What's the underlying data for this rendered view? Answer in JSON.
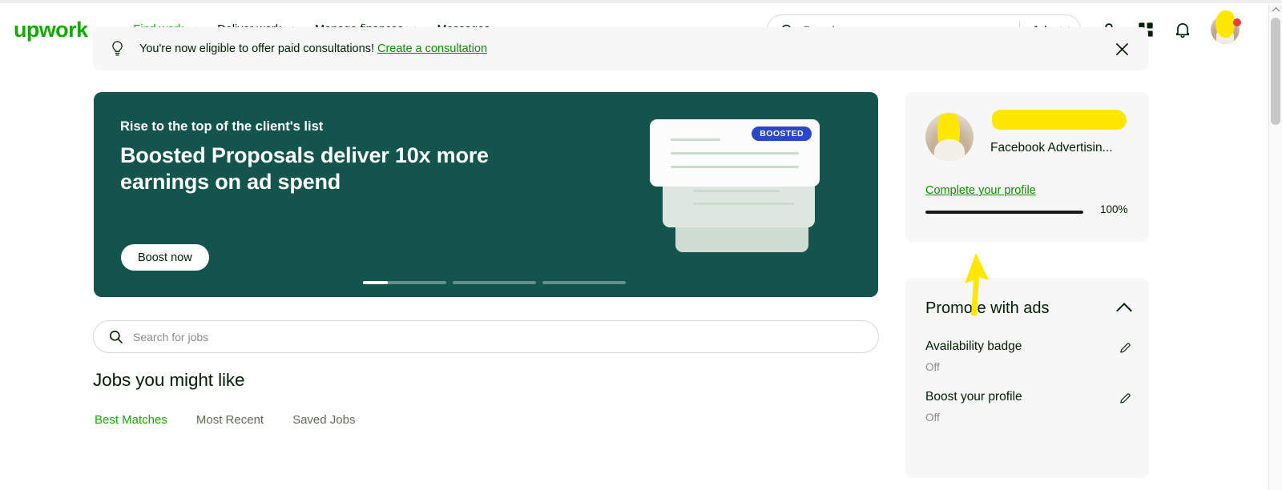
{
  "brand": {
    "logo_text": "upwork",
    "green": "#14a800",
    "hero_green": "#13544d",
    "badge_blue": "#2a46cc"
  },
  "header": {
    "nav": [
      {
        "label": "Find work",
        "has_caret": true,
        "active": true
      },
      {
        "label": "Deliver work",
        "has_caret": true,
        "active": false
      },
      {
        "label": "Manage finances",
        "has_caret": true,
        "active": false
      },
      {
        "label": "Messages",
        "has_caret": false,
        "active": false
      }
    ],
    "search": {
      "placeholder": "Search",
      "value": "",
      "scope": "Jobs"
    },
    "icons": [
      "help-icon",
      "apps-grid-icon",
      "notifications-bell-icon",
      "avatar"
    ]
  },
  "alert": {
    "icon": "lightbulb-icon",
    "text": "You're now eligible to offer paid consultations!",
    "link": "Create a consultation",
    "close": "close-icon"
  },
  "hero": {
    "eyebrow": "Rise to the top of the client's list",
    "title": "Boosted Proposals deliver 10x more earnings on ad spend",
    "button": "Boost now",
    "badge": "BOOSTED",
    "slides": 3,
    "active_slide": 1
  },
  "job_search": {
    "placeholder": "Search for jobs",
    "value": ""
  },
  "main": {
    "section_title": "Jobs you might like",
    "tabs": [
      {
        "label": "Best Matches",
        "active": true
      },
      {
        "label": "Most Recent",
        "active": false
      },
      {
        "label": "Saved Jobs",
        "active": false
      }
    ]
  },
  "sidebar": {
    "profile": {
      "name": "",
      "title": "Facebook Advertisin...",
      "complete_link": "Complete your profile",
      "progress_percent": "100%",
      "progress_value": 100
    },
    "promote": {
      "heading": "Promote with ads",
      "collapse_icon": "chevron-up-icon",
      "items": [
        {
          "label": "Availability badge",
          "state": "Off",
          "edit_icon": "pencil-icon"
        },
        {
          "label": "Boost your profile",
          "state": "Off",
          "edit_icon": "pencil-icon"
        }
      ]
    }
  }
}
